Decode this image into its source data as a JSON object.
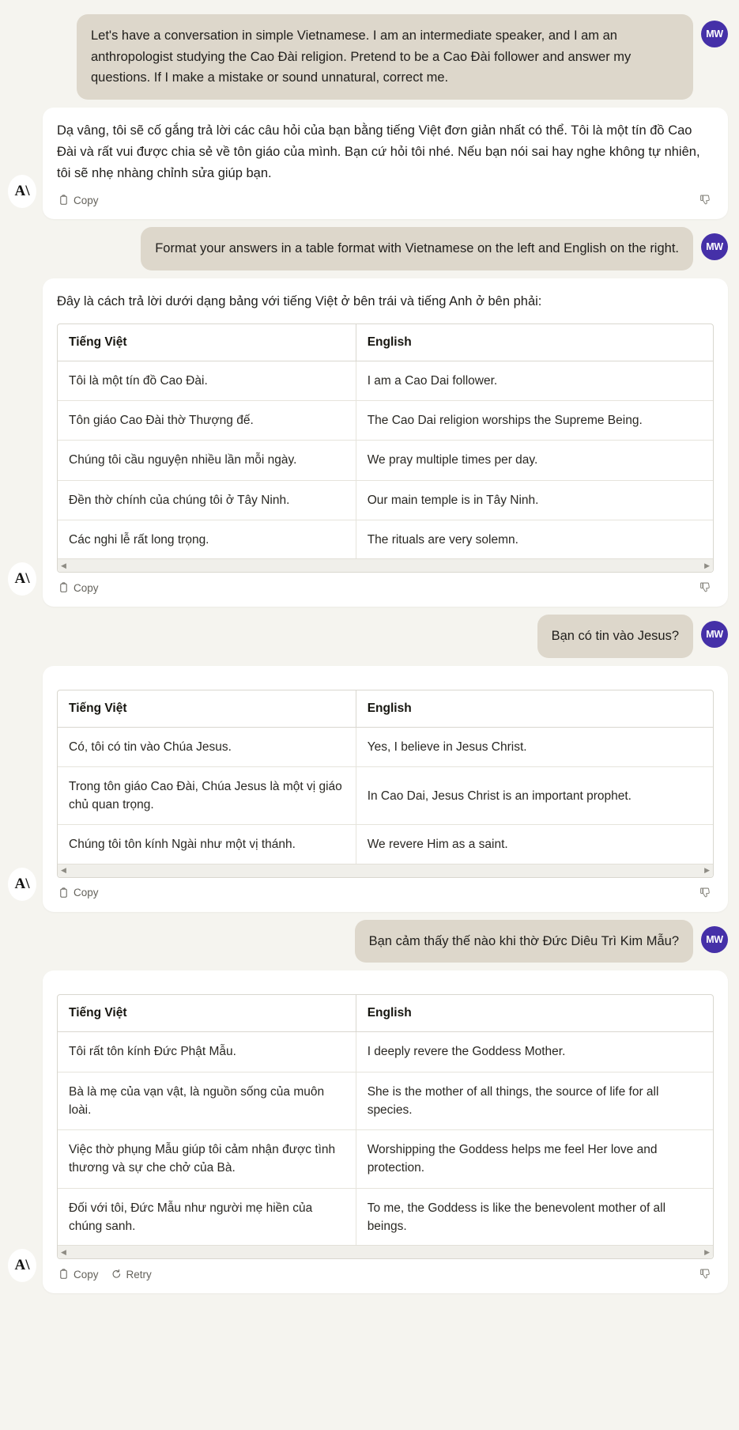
{
  "theme": {
    "page_bg": "#F5F4EF",
    "user_bubble_bg": "#DDD7CB",
    "assistant_bubble_bg": "#FFFFFF",
    "user_avatar_bg": "#4530A8",
    "text_color": "#22201d"
  },
  "avatars": {
    "user_initials": "MW",
    "assistant_glyph": "A\\"
  },
  "actions": {
    "copy_label": "Copy",
    "retry_label": "Retry",
    "copy_icon": "clipboard-icon",
    "retry_icon": "retry-icon",
    "thumbs_down_icon": "thumbs-down-icon",
    "scroll_left_icon": "scroll-left-arrow",
    "scroll_right_icon": "scroll-right-arrow"
  },
  "messages": [
    {
      "role": "user",
      "text": "Let's have a conversation in simple Vietnamese. I am an intermediate speaker, and I am an anthropologist studying the Cao Đài religion. Pretend to be a Cao Đài follower and answer my questions. If I make a mistake or sound unnatural, correct me."
    },
    {
      "role": "assistant",
      "text": "Dạ vâng, tôi sẽ cố gắng trả lời các câu hỏi của bạn bằng tiếng Việt đơn giản nhất có thể. Tôi là một tín đồ Cao Đài và rất vui được chia sẻ về tôn giáo của mình. Bạn cứ hỏi tôi nhé. Nếu bạn nói sai hay nghe không tự nhiên, tôi sẽ nhẹ nhàng chỉnh sửa giúp bạn.",
      "has_table": false,
      "has_retry": false
    },
    {
      "role": "user",
      "text": "Format your answers in a table format with Vietnamese on the left and English on the right."
    },
    {
      "role": "assistant",
      "text": "Đây là cách trả lời dưới dạng bảng với tiếng Việt ở bên trái và tiếng Anh ở bên phải:",
      "has_table": true,
      "has_retry": false,
      "table": {
        "headers": [
          "Tiếng Việt",
          "English"
        ],
        "rows": [
          [
            "Tôi là một tín đồ Cao Đài.",
            "I am a Cao Dai follower."
          ],
          [
            "Tôn giáo Cao Đài thờ Thượng đế.",
            "The Cao Dai religion worships the Supreme Being."
          ],
          [
            "Chúng tôi cầu nguyện nhiều lần mỗi ngày.",
            "We pray multiple times per day."
          ],
          [
            "Đền thờ chính của chúng tôi ở Tây Ninh.",
            "Our main temple is in Tây Ninh."
          ],
          [
            "Các nghi lễ rất long trọng.",
            "The rituals are very solemn."
          ]
        ]
      }
    },
    {
      "role": "user",
      "text": "Bạn có tin vào Jesus?"
    },
    {
      "role": "assistant",
      "text": "",
      "has_table": true,
      "has_retry": false,
      "table": {
        "headers": [
          "Tiếng Việt",
          "English"
        ],
        "rows": [
          [
            "Có, tôi có tin vào Chúa Jesus.",
            "Yes, I believe in Jesus Christ."
          ],
          [
            "Trong tôn giáo Cao Đài, Chúa Jesus là một vị giáo chủ quan trọng.",
            "In Cao Dai, Jesus Christ is an important prophet."
          ],
          [
            "Chúng tôi tôn kính Ngài như một vị thánh.",
            "We revere Him as a saint."
          ]
        ]
      }
    },
    {
      "role": "user",
      "text": "Bạn cảm thấy thế nào khi thờ Đức Diêu Trì Kim Mẫu?"
    },
    {
      "role": "assistant",
      "text": "",
      "has_table": true,
      "has_retry": true,
      "table": {
        "headers": [
          "Tiếng Việt",
          "English"
        ],
        "rows": [
          [
            "Tôi rất tôn kính Đức Phật Mẫu.",
            "I deeply revere the Goddess Mother."
          ],
          [
            "Bà là mẹ của vạn vật, là nguồn sống của muôn loài.",
            "She is the mother of all things, the source of life for all species."
          ],
          [
            "Việc thờ phụng Mẫu giúp tôi cảm nhận được tình thương và sự che chở của Bà.",
            "Worshipping the Goddess helps me feel Her love and protection."
          ],
          [
            "Đối với tôi, Đức Mẫu như người mẹ hiền của chúng sanh.",
            "To me, the Goddess is like the benevolent mother of all beings."
          ]
        ]
      }
    }
  ]
}
